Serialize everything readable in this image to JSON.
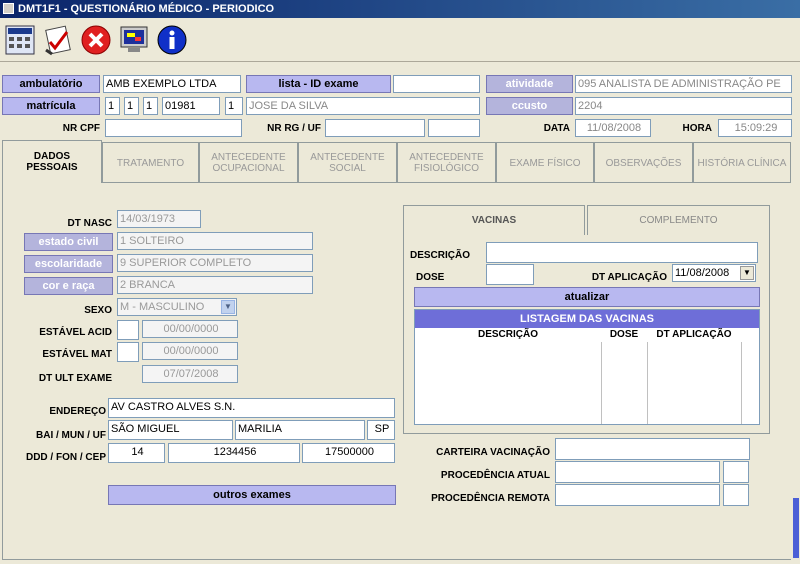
{
  "window": {
    "title": "DMT1F1 - QUESTIONÁRIO MÉDICO - PERIODICO"
  },
  "toolbar": {
    "icons": [
      "calculator-grid-icon",
      "checklist-icon",
      "close-icon",
      "monitor-icon",
      "info-icon"
    ]
  },
  "header": {
    "ambulatorio_label": "ambulatório",
    "ambulatorio_value": "AMB EXEMPLO LTDA",
    "lista_label": "lista - ID exame",
    "lista_value": "",
    "atividade_label": "atividade",
    "atividade_value": "095 ANALISTA DE ADMINISTRAÇÃO PE",
    "matricula_label": "matrícula",
    "matricula_f1": "1",
    "matricula_f2": "1",
    "matricula_f3": "1",
    "matricula_f4": "01981",
    "matricula_f5": "1",
    "matricula_name": "JOSE DA SILVA",
    "ccusto_label": "ccusto",
    "ccusto_value": "2204",
    "nrcpf_label": "NR CPF",
    "nrcpf_value": "",
    "nrrg_label": "NR RG / UF",
    "nrrg_value": "",
    "nrrg_uf": "",
    "data_label": "DATA",
    "data_value": "11/08/2008",
    "hora_label": "HORA",
    "hora_value": "15:09:29"
  },
  "tabs": [
    {
      "line1": "DADOS",
      "line2": "PESSOAIS"
    },
    {
      "line1": "TRATAMENTO",
      "line2": ""
    },
    {
      "line1": "ANTECEDENTE",
      "line2": "OCUPACIONAL"
    },
    {
      "line1": "ANTECEDENTE",
      "line2": "SOCIAL"
    },
    {
      "line1": "ANTECEDENTE",
      "line2": "FISIOLÓGICO"
    },
    {
      "line1": "EXAME FÍSICO",
      "line2": ""
    },
    {
      "line1": "OBSERVAÇÕES",
      "line2": ""
    },
    {
      "line1": "HISTÓRIA CLÍNICA",
      "line2": ""
    }
  ],
  "personal": {
    "dtnasc_label": "DT NASC",
    "dtnasc_value": "14/03/1973",
    "estado_civil_label": "estado civil",
    "estado_civil_value": "1 SOLTEIRO",
    "escolaridade_label": "escolaridade",
    "escolaridade_value": "9 SUPERIOR COMPLETO",
    "cor_label": "cor e raça",
    "cor_value": "2 BRANCA",
    "sexo_label": "SEXO",
    "sexo_value": "M - MASCULINO",
    "estavel_acid_label": "ESTÁVEL ACID",
    "estavel_acid_value": "00/00/0000",
    "estavel_mat_label": "ESTÁVEL MAT",
    "estavel_mat_value": "00/00/0000",
    "dtult_label": "DT ULT EXAME",
    "dtult_value": "07/07/2008",
    "endereco_label": "ENDEREÇO",
    "endereco_value": "AV CASTRO ALVES S.N.",
    "bai_label": "BAI / MUN / UF",
    "bairro_value": "SÃO MIGUEL",
    "municipio_value": "MARILIA",
    "uf_value": "SP",
    "ddd_label": "DDD / FON / CEP",
    "ddd_value": "14",
    "fone_value": "1234456",
    "cep_value": "17500000",
    "outros_exames": "outros exames"
  },
  "vacinas": {
    "tab_vacinas": "VACINAS",
    "tab_complemento": "COMPLEMENTO",
    "descricao_label": "DESCRIÇÃO",
    "descricao_value": "",
    "dose_label": "DOSE",
    "dose_value": "",
    "dtaplic_label": "DT APLICAÇÃO",
    "dtaplic_value": "11/08/2008",
    "atualizar": "atualizar",
    "listagem_title": "LISTAGEM DAS VACINAS",
    "col_descricao": "DESCRIÇÃO",
    "col_dose": "DOSE",
    "col_dtaplic": "DT APLICAÇÃO"
  },
  "footer_fields": {
    "carteira_label": "CARTEIRA VACINAÇÃO",
    "carteira_value": "",
    "proc_atual_label": "PROCEDÊNCIA ATUAL",
    "proc_atual_value": "",
    "proc_atual_extra": "",
    "proc_remota_label": "PROCEDÊNCIA REMOTA",
    "proc_remota_value": "",
    "proc_remota_extra": ""
  }
}
